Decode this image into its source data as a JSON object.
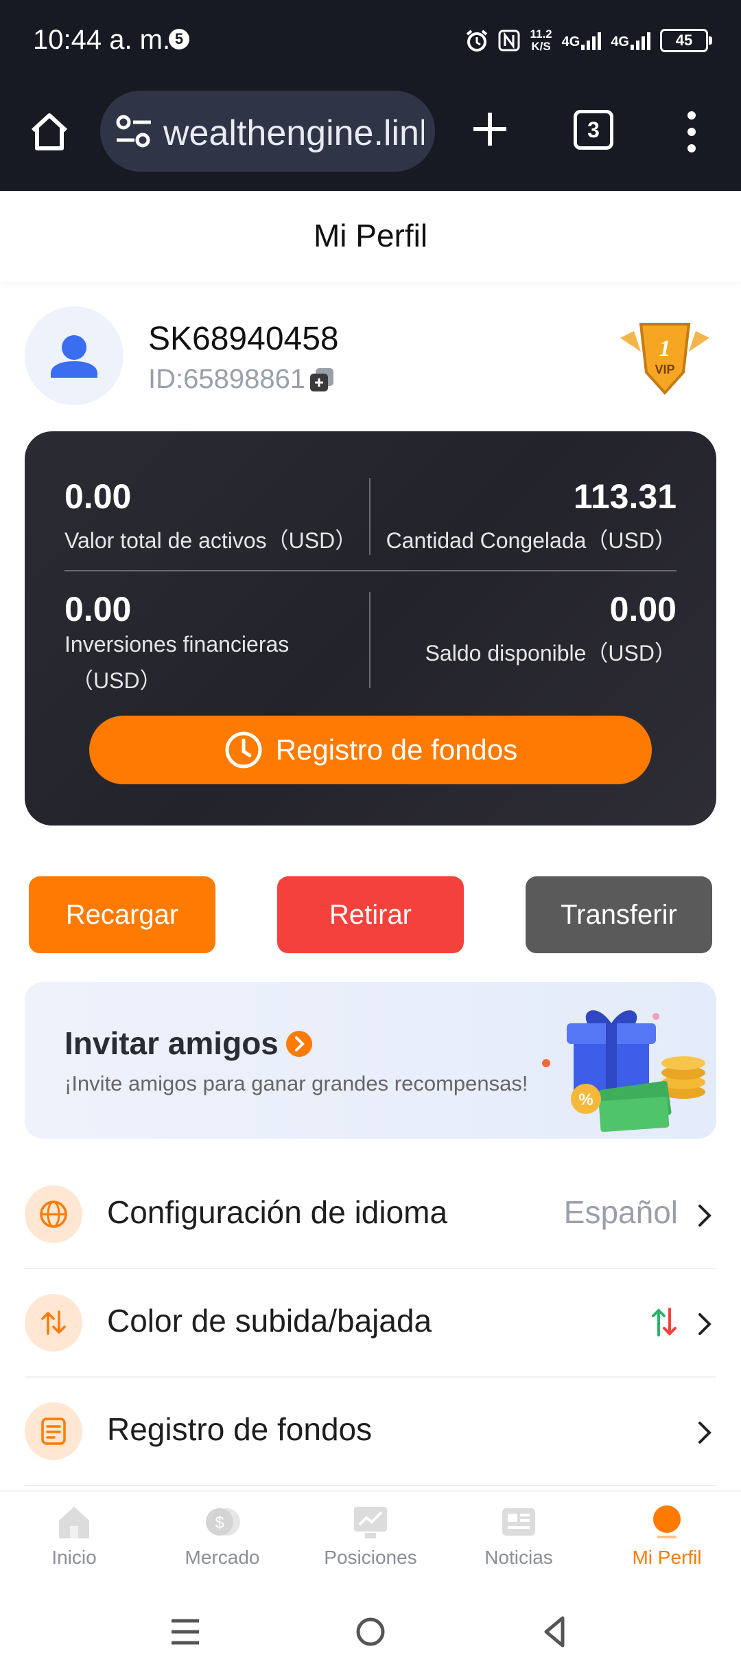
{
  "status_bar": {
    "time": "10:44 a. m.",
    "notification_count": "5",
    "speed_value": "11.2",
    "speed_unit": "K/S",
    "network_1": "4G",
    "network_2": "4G",
    "battery": "45"
  },
  "browser": {
    "url": "wealthengine.link",
    "tab_count": "3"
  },
  "header": {
    "title": "Mi Perfil"
  },
  "profile": {
    "username": "SK68940458",
    "user_id": "ID:65898861",
    "vip_level": "1",
    "vip_label": "VIP"
  },
  "assets": {
    "total_value": "0.00",
    "total_label": "Valor total de activos（USD）",
    "frozen_value": "113.31",
    "frozen_label": "Cantidad Congelada（USD）",
    "investments_value": "0.00",
    "investments_label_1": "Inversiones financieras",
    "investments_label_2": "（USD）",
    "available_value": "0.00",
    "available_label": "Saldo disponible（USD）",
    "funds_button": "Registro de fondos"
  },
  "actions": {
    "recharge": "Recargar",
    "withdraw": "Retirar",
    "transfer": "Transferir"
  },
  "invite": {
    "title": "Invitar amigos",
    "subtitle": "¡Invite amigos para ganar grandes recompensas!"
  },
  "settings": [
    {
      "label": "Configuración de idioma",
      "value": "Español"
    },
    {
      "label": "Color de subida/bajada",
      "value": ""
    },
    {
      "label": "Registro de fondos",
      "value": ""
    }
  ],
  "bottom_nav": [
    {
      "label": "Inicio"
    },
    {
      "label": "Mercado"
    },
    {
      "label": "Posiciones"
    },
    {
      "label": "Noticias"
    },
    {
      "label": "Mi Perfil",
      "active": true
    }
  ],
  "colors": {
    "accent": "#ff7a00",
    "withdraw": "#f5413b",
    "transfer": "#5a5a5a",
    "card_bg": "#26262e"
  }
}
